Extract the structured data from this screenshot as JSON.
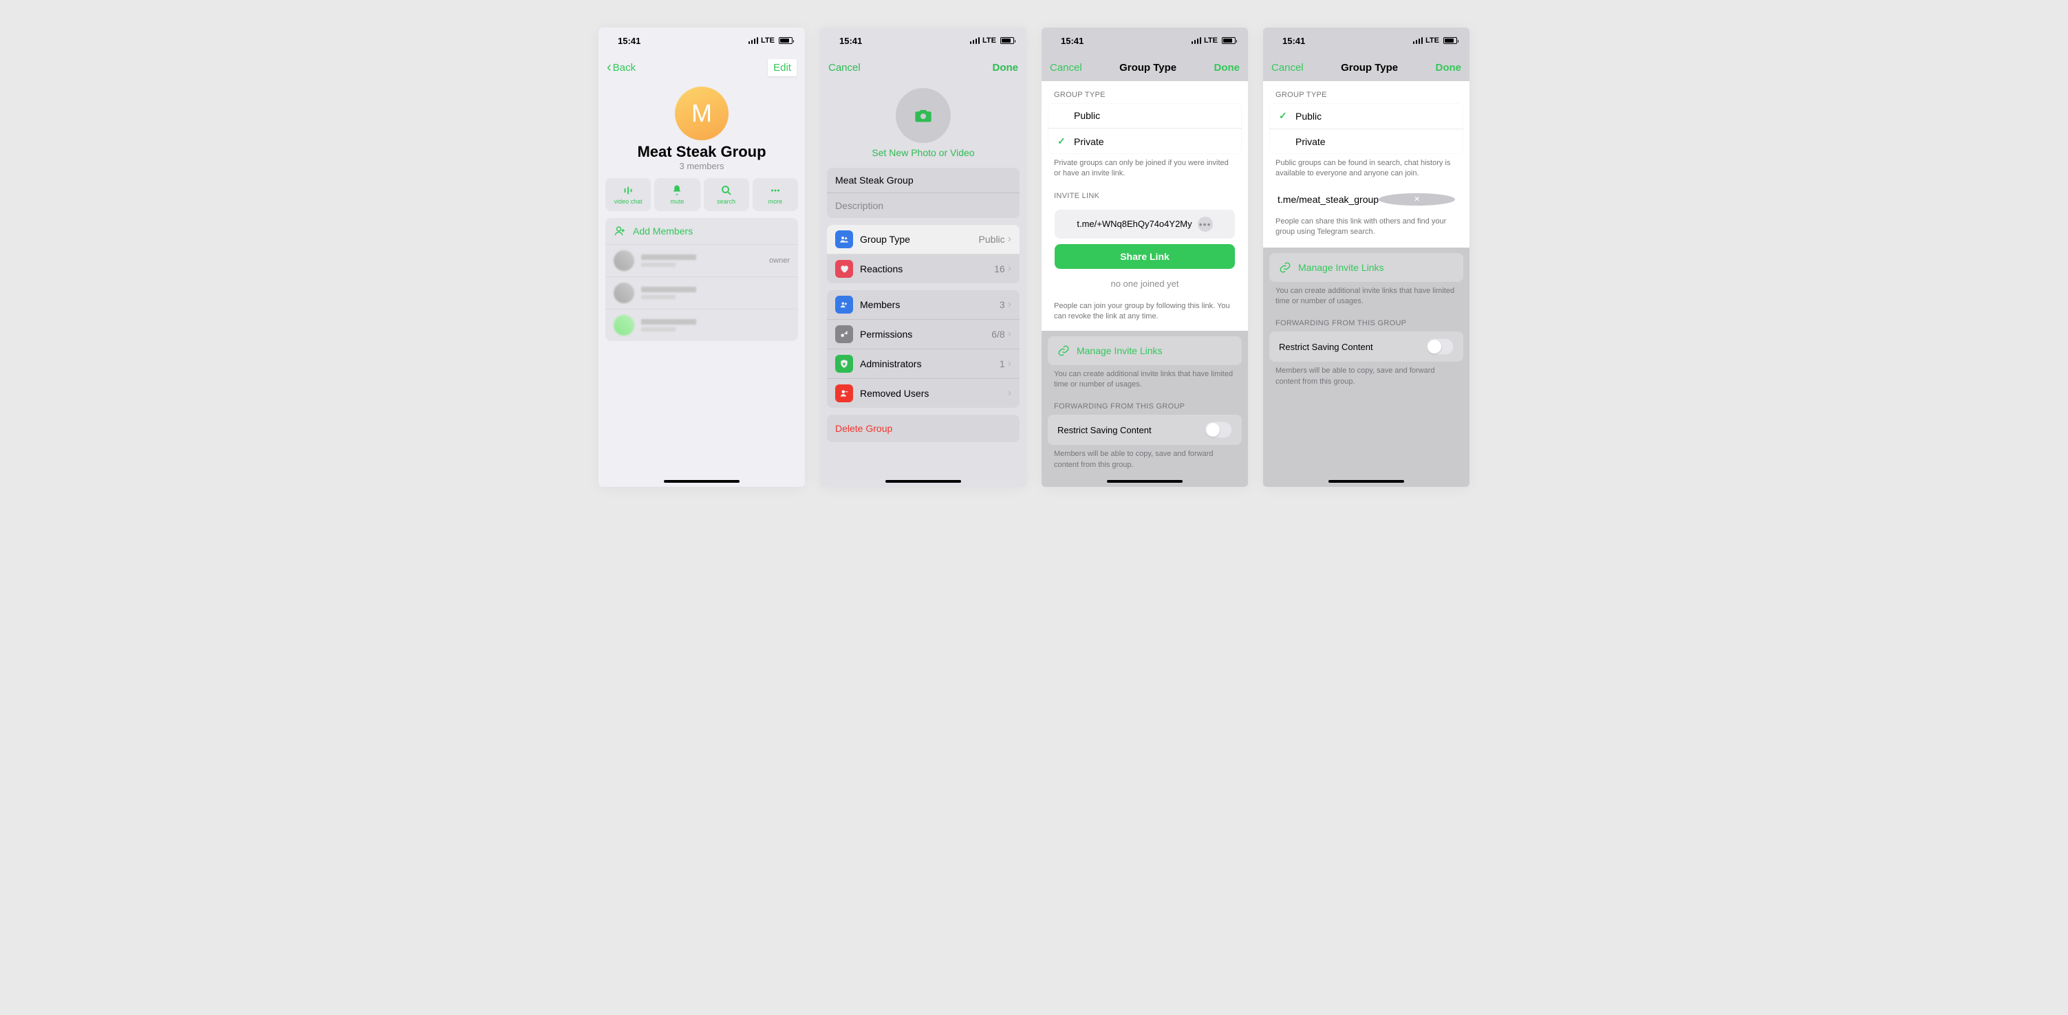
{
  "common": {
    "time": "15:41",
    "lte": "LTE",
    "done": "Done",
    "cancel": "Cancel"
  },
  "screen1": {
    "back": "Back",
    "edit": "Edit",
    "avatar_letter": "M",
    "title": "Meat Steak Group",
    "subtitle": "3 members",
    "actions": {
      "video": "video chat",
      "mute": "mute",
      "search": "search",
      "more": "more"
    },
    "add_members": "Add Members",
    "owner_tag": "owner"
  },
  "screen2": {
    "set_photo": "Set New Photo or Video",
    "group_name": "Meat Steak Group",
    "desc_placeholder": "Description",
    "cells": {
      "group_type_label": "Group Type",
      "group_type_value": "Public",
      "reactions_label": "Reactions",
      "reactions_value": "16",
      "members_label": "Members",
      "members_value": "3",
      "permissions_label": "Permissions",
      "permissions_value": "6/8",
      "admins_label": "Administrators",
      "admins_value": "1",
      "removed_label": "Removed Users"
    },
    "delete": "Delete Group"
  },
  "screen3": {
    "nav_title": "Group Type",
    "section_type": "GROUP TYPE",
    "public": "Public",
    "private": "Private",
    "type_note": "Private groups can only be joined if you were invited or have an invite link.",
    "section_invite": "INVITE LINK",
    "invite_link": "t.me/+WNq8EhQy74o4Y2My",
    "share": "Share Link",
    "no_joined": "no one joined yet",
    "invite_note": "People can join your group by following this link. You can revoke the link at any time.",
    "manage": "Manage Invite Links",
    "manage_note": "You can create additional invite links that have limited time or number of usages.",
    "section_fwd": "FORWARDING FROM THIS GROUP",
    "restrict": "Restrict Saving Content",
    "restrict_note": "Members will be able to copy, save and forward content from this group."
  },
  "screen4": {
    "nav_title": "Group Type",
    "section_type": "GROUP TYPE",
    "public": "Public",
    "private": "Private",
    "type_note": "Public groups can be found in search, chat history is available to everyone and anyone can join.",
    "public_link": "t.me/meat_steak_group",
    "link_note": "People can share this link with others and find your group using Telegram search.",
    "manage": "Manage Invite Links",
    "manage_note": "You can create additional invite links that have limited time or number of usages.",
    "section_fwd": "FORWARDING FROM THIS GROUP",
    "restrict": "Restrict Saving Content",
    "restrict_note": "Members will be able to copy, save and forward content from this group."
  }
}
